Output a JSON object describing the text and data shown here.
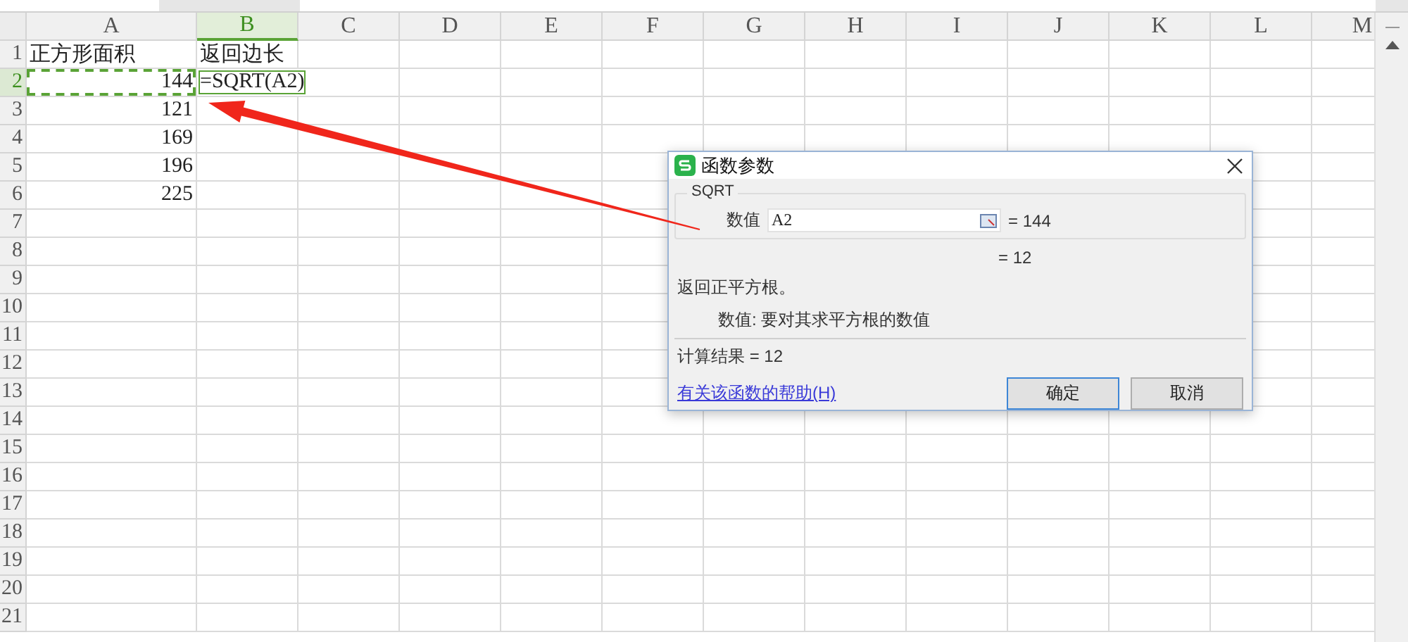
{
  "columns": [
    {
      "label": "A",
      "selected": false
    },
    {
      "label": "B",
      "selected": true
    },
    {
      "label": "C",
      "selected": false
    },
    {
      "label": "D",
      "selected": false
    },
    {
      "label": "E",
      "selected": false
    },
    {
      "label": "F",
      "selected": false
    },
    {
      "label": "G",
      "selected": false
    },
    {
      "label": "H",
      "selected": false
    },
    {
      "label": "I",
      "selected": false
    },
    {
      "label": "J",
      "selected": false
    },
    {
      "label": "K",
      "selected": false
    },
    {
      "label": "L",
      "selected": false
    },
    {
      "label": "M",
      "selected": false
    }
  ],
  "rows": [
    {
      "label": "1",
      "selected": false,
      "cells": [
        {
          "text": "正方形面积",
          "kind": "text",
          "marquee": false,
          "active": false
        },
        {
          "text": "返回边长",
          "kind": "text",
          "marquee": false,
          "active": false
        }
      ]
    },
    {
      "label": "2",
      "selected": true,
      "cells": [
        {
          "text": "144",
          "kind": "number",
          "marquee": true,
          "active": false
        },
        {
          "text": "=SQRT(A2)",
          "kind": "text",
          "marquee": false,
          "active": true
        }
      ]
    },
    {
      "label": "3",
      "selected": false,
      "cells": [
        {
          "text": "121",
          "kind": "number",
          "marquee": false,
          "active": false
        }
      ]
    },
    {
      "label": "4",
      "selected": false,
      "cells": [
        {
          "text": "169",
          "kind": "number",
          "marquee": false,
          "active": false
        }
      ]
    },
    {
      "label": "5",
      "selected": false,
      "cells": [
        {
          "text": "196",
          "kind": "number",
          "marquee": false,
          "active": false
        }
      ]
    },
    {
      "label": "6",
      "selected": false,
      "cells": [
        {
          "text": "225",
          "kind": "number",
          "marquee": false,
          "active": false
        }
      ]
    },
    {
      "label": "7",
      "selected": false
    },
    {
      "label": "8",
      "selected": false
    },
    {
      "label": "9",
      "selected": false
    },
    {
      "label": "10",
      "selected": false
    },
    {
      "label": "11",
      "selected": false
    },
    {
      "label": "12",
      "selected": false
    },
    {
      "label": "13",
      "selected": false
    },
    {
      "label": "14",
      "selected": false
    },
    {
      "label": "15",
      "selected": false
    },
    {
      "label": "16",
      "selected": false
    },
    {
      "label": "17",
      "selected": false
    },
    {
      "label": "18",
      "selected": false
    },
    {
      "label": "19",
      "selected": false
    },
    {
      "label": "20",
      "selected": false
    },
    {
      "label": "21",
      "selected": false
    }
  ],
  "dialog": {
    "title": "函数参数",
    "function_name": "SQRT",
    "argument": {
      "label": "数值",
      "value": "A2",
      "result": "= 144"
    },
    "formula_result": "= 12",
    "description": "返回正平方根。",
    "argument_help": "数值:  要对其求平方根的数值",
    "computed": "计算结果 = 12",
    "help_link": "有关该函数的帮助(H)",
    "buttons": [
      {
        "label": "确定",
        "default": true
      },
      {
        "label": "取消",
        "default": false
      }
    ]
  }
}
